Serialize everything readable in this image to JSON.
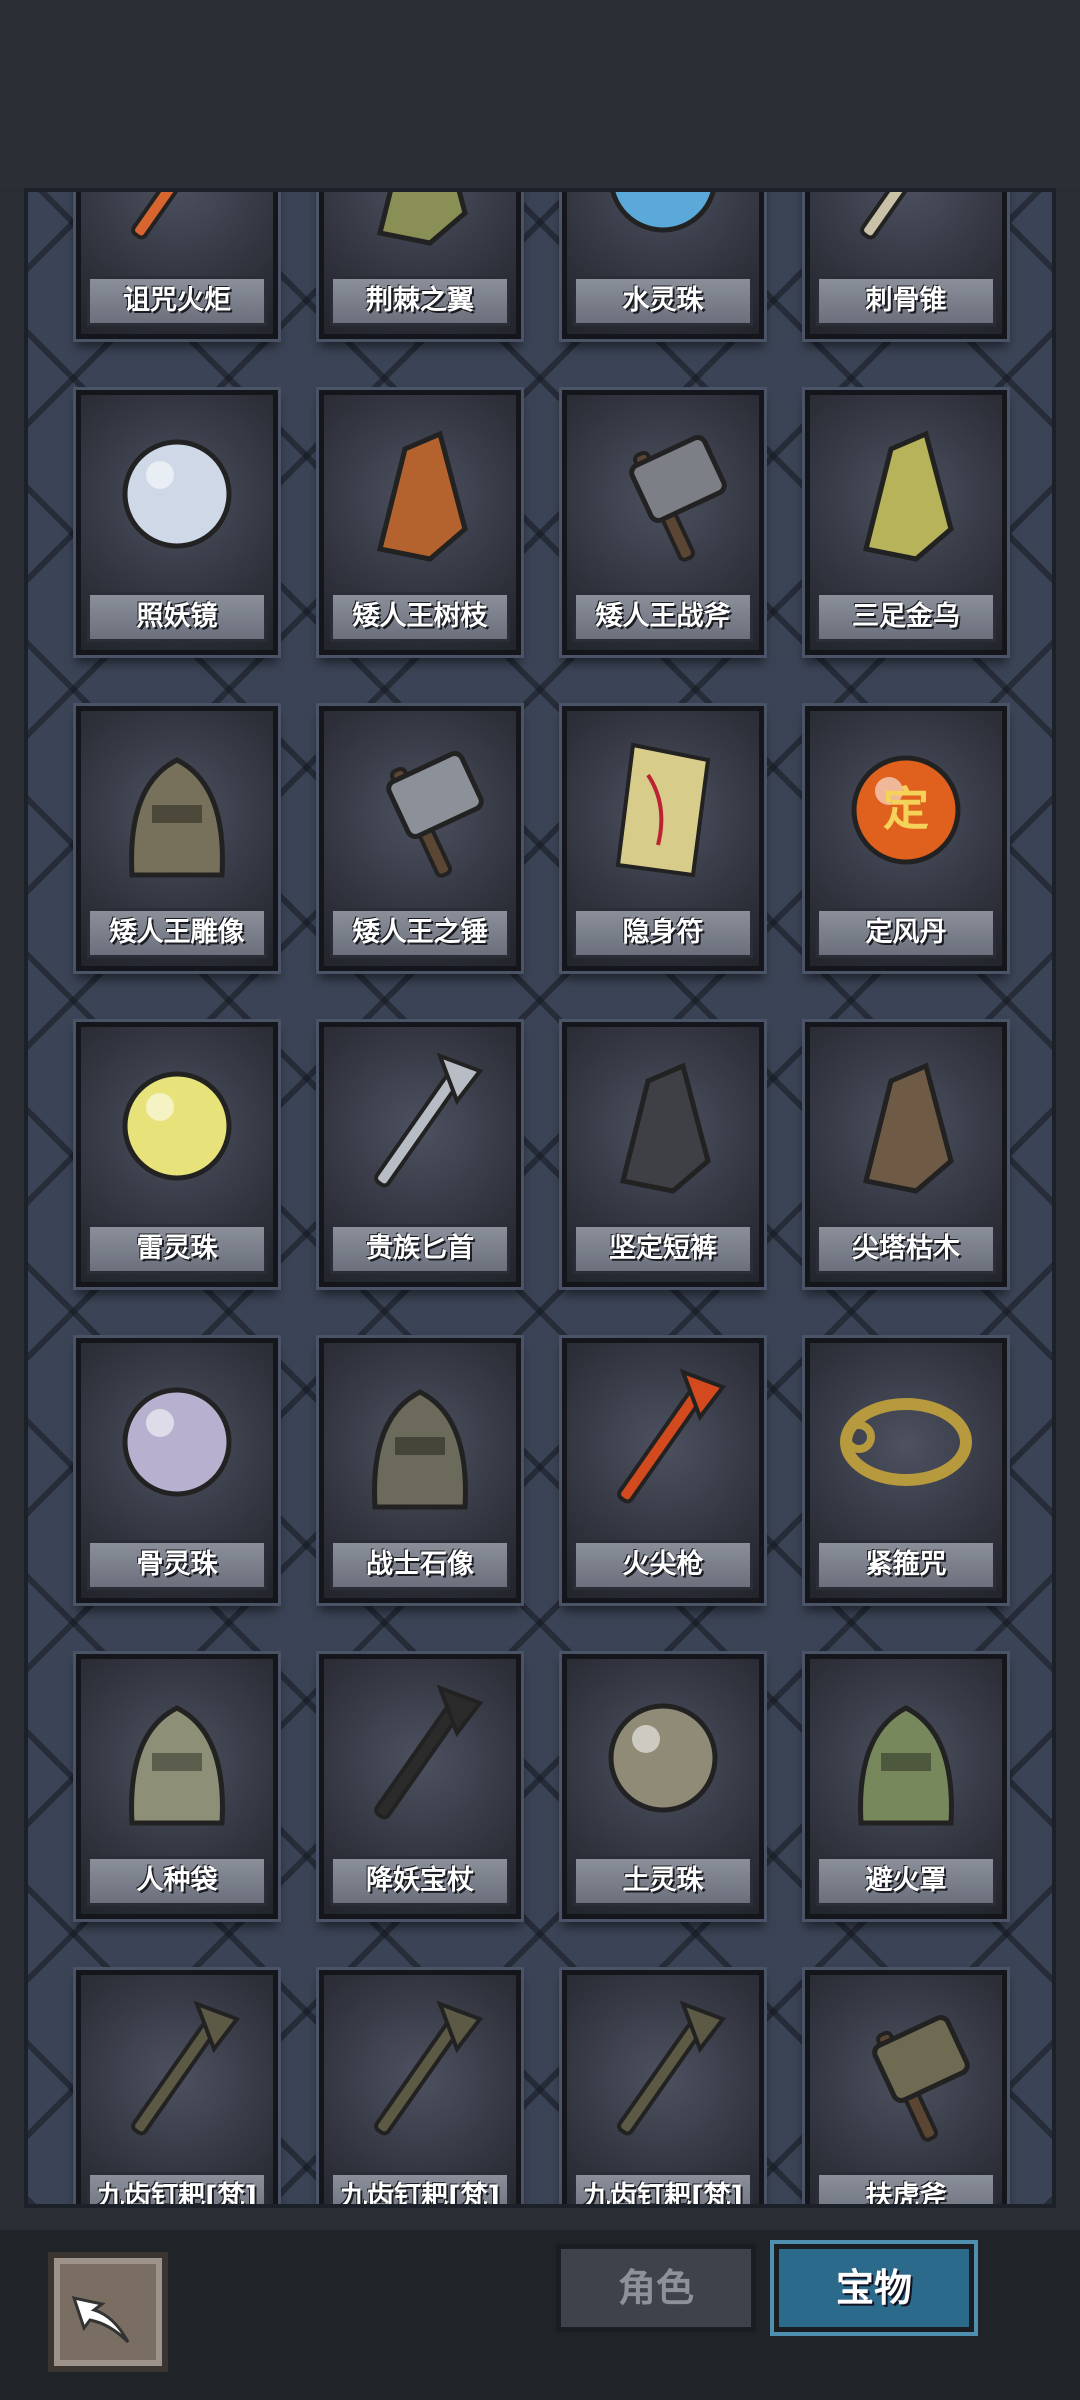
{
  "items": [
    {
      "name": "诅咒火炬",
      "icon": "torch-icon"
    },
    {
      "name": "荆棘之翼",
      "icon": "wing-icon"
    },
    {
      "name": "水灵珠",
      "icon": "water-orb-icon"
    },
    {
      "name": "刺骨锥",
      "icon": "bone-awl-icon"
    },
    {
      "name": "照妖镜",
      "icon": "mirror-icon"
    },
    {
      "name": "矮人王树枝",
      "icon": "branch-icon"
    },
    {
      "name": "矮人王战斧",
      "icon": "battle-axe-icon"
    },
    {
      "name": "三足金乌",
      "icon": "golden-crow-icon"
    },
    {
      "name": "矮人王雕像",
      "icon": "statue-icon"
    },
    {
      "name": "矮人王之锤",
      "icon": "hammer-icon"
    },
    {
      "name": "隐身符",
      "icon": "talisman-icon"
    },
    {
      "name": "定风丹",
      "icon": "wind-pill-icon",
      "glyph": "定"
    },
    {
      "name": "雷灵珠",
      "icon": "thunder-orb-icon"
    },
    {
      "name": "贵族匕首",
      "icon": "dagger-icon"
    },
    {
      "name": "坚定短裤",
      "icon": "shorts-icon"
    },
    {
      "name": "尖塔枯木",
      "icon": "dead-wood-icon"
    },
    {
      "name": "骨灵珠",
      "icon": "bone-orb-icon"
    },
    {
      "name": "战士石像",
      "icon": "stone-warrior-icon"
    },
    {
      "name": "火尖枪",
      "icon": "fire-spear-icon"
    },
    {
      "name": "紧箍咒",
      "icon": "headband-icon"
    },
    {
      "name": "人种袋",
      "icon": "bag-icon"
    },
    {
      "name": "降妖宝杖",
      "icon": "staff-icon"
    },
    {
      "name": "土灵珠",
      "icon": "earth-orb-icon"
    },
    {
      "name": "避火罩",
      "icon": "fire-mask-icon"
    },
    {
      "name": "九齿钉耙[梵]",
      "icon": "rake-icon"
    },
    {
      "name": "九齿钉耙[梵]",
      "icon": "rake-icon"
    },
    {
      "name": "九齿钉耙[梵]",
      "icon": "rake-icon"
    },
    {
      "name": "扶虎斧",
      "icon": "axe-icon"
    }
  ],
  "tabs": {
    "role": "角色",
    "treasure": "宝物"
  },
  "active_tab": "treasure",
  "colors": {
    "panel": "#3b4456",
    "label_bg": "#7b808c",
    "active_tab": "#2b6a8a"
  }
}
